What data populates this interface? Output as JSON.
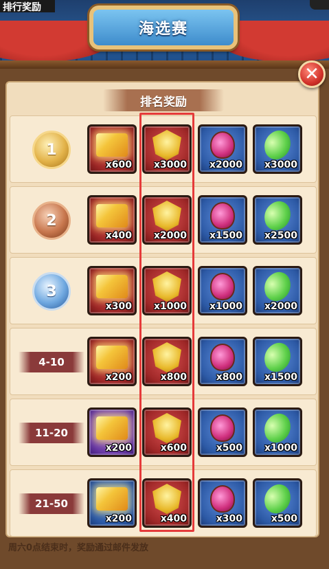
{
  "window": {
    "top_left_label": "排行奖励",
    "title": "海选赛",
    "close_label": "✕"
  },
  "section": {
    "header": "排名奖励"
  },
  "rows": [
    {
      "rank_type": "medal",
      "medal_style": "gold",
      "rank_label": "1",
      "items": [
        {
          "kind": "chest",
          "frame": "red",
          "qty": "x600"
        },
        {
          "kind": "badge",
          "frame": "red",
          "qty": "x3000"
        },
        {
          "kind": "potion",
          "frame": "blue",
          "qty": "x2000"
        },
        {
          "kind": "gem",
          "frame": "blue",
          "qty": "x3000"
        }
      ]
    },
    {
      "rank_type": "medal",
      "medal_style": "bronze",
      "rank_label": "2",
      "items": [
        {
          "kind": "chest",
          "frame": "red",
          "qty": "x400"
        },
        {
          "kind": "badge",
          "frame": "red",
          "qty": "x2000"
        },
        {
          "kind": "potion",
          "frame": "blue",
          "qty": "x1500"
        },
        {
          "kind": "gem",
          "frame": "blue",
          "qty": "x2500"
        }
      ]
    },
    {
      "rank_type": "medal",
      "medal_style": "silver",
      "rank_label": "3",
      "items": [
        {
          "kind": "chest",
          "frame": "red",
          "qty": "x300"
        },
        {
          "kind": "badge",
          "frame": "red",
          "qty": "x1000"
        },
        {
          "kind": "potion",
          "frame": "blue",
          "qty": "x1000"
        },
        {
          "kind": "gem",
          "frame": "blue",
          "qty": "x2000"
        }
      ]
    },
    {
      "rank_type": "banner",
      "rank_label": "4-10",
      "items": [
        {
          "kind": "chest",
          "frame": "red",
          "qty": "x200"
        },
        {
          "kind": "badge",
          "frame": "red",
          "qty": "x800"
        },
        {
          "kind": "potion",
          "frame": "blue",
          "qty": "x800"
        },
        {
          "kind": "gem",
          "frame": "blue",
          "qty": "x1500"
        }
      ]
    },
    {
      "rank_type": "banner",
      "rank_label": "11-20",
      "items": [
        {
          "kind": "chest",
          "frame": "purple",
          "qty": "x200"
        },
        {
          "kind": "badge",
          "frame": "red",
          "qty": "x600"
        },
        {
          "kind": "potion",
          "frame": "blue",
          "qty": "x500"
        },
        {
          "kind": "gem",
          "frame": "blue",
          "qty": "x1000"
        }
      ]
    },
    {
      "rank_type": "banner",
      "rank_label": "21-50",
      "items": [
        {
          "kind": "chest",
          "frame": "blue",
          "qty": "x200"
        },
        {
          "kind": "badge",
          "frame": "red",
          "qty": "x400"
        },
        {
          "kind": "potion",
          "frame": "blue",
          "qty": "x300"
        },
        {
          "kind": "gem",
          "frame": "blue",
          "qty": "x500"
        }
      ]
    }
  ],
  "footer": {
    "note": "周六0点结束时，奖励通过邮件发放"
  },
  "colors": {
    "highlight": "#e53a3a",
    "panel_bg": "#f1ddbd",
    "title_blue": "#3e8ccc"
  }
}
